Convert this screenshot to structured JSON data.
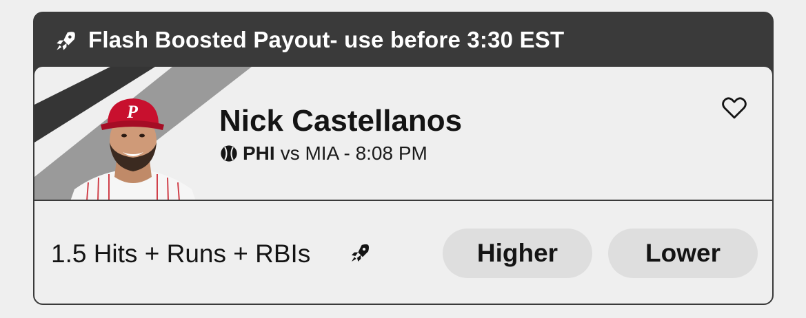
{
  "banner": {
    "text": "Flash Boosted Payout- use before 3:30 EST",
    "icon": "rocket-icon"
  },
  "player": {
    "name": "Nick Castellanos",
    "team": "PHI",
    "matchup_rest": "vs MIA - 8:08 PM",
    "sport_icon": "baseball-icon",
    "favorite_icon": "heart-icon"
  },
  "prop": {
    "line": "1.5 Hits + Runs + RBIs",
    "boost_icon": "rocket-icon"
  },
  "buttons": {
    "higher": "Higher",
    "lower": "Lower"
  },
  "colors": {
    "banner_bg": "#3a3a3a",
    "card_bg": "#efefef",
    "button_bg": "#dedede",
    "cap_red": "#c8102e"
  }
}
